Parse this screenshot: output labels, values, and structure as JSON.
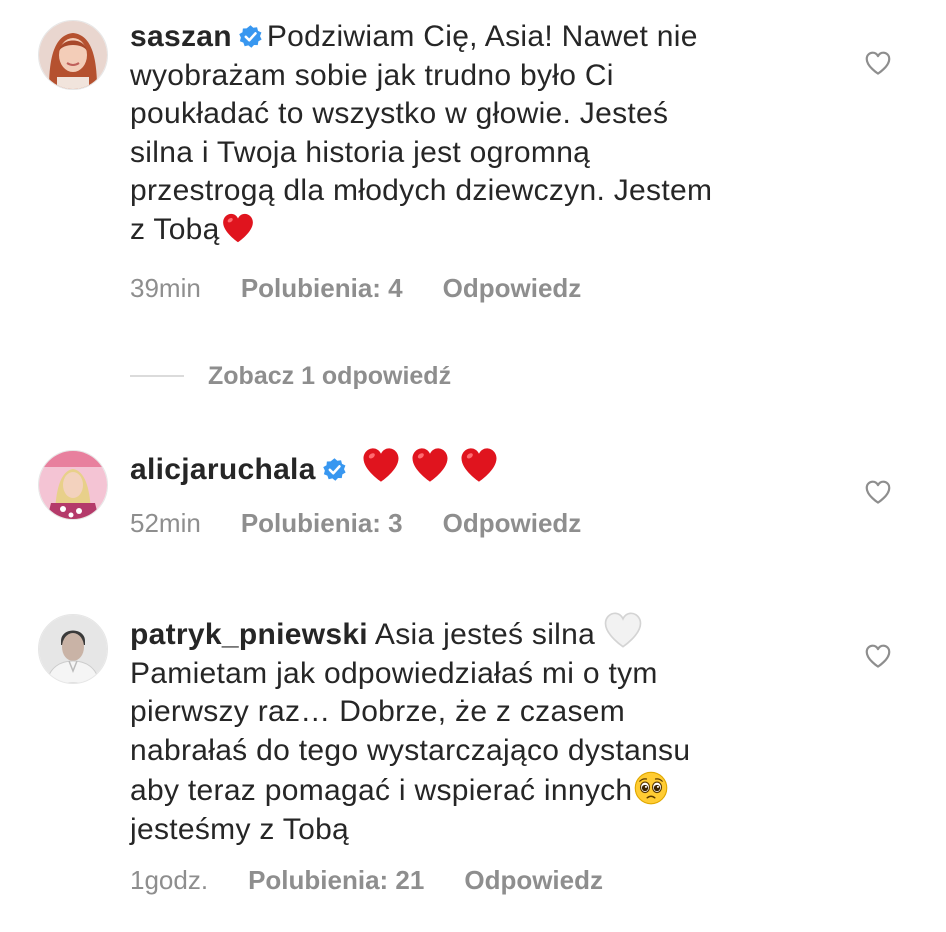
{
  "comments": [
    {
      "username": "saszan",
      "text_lines": [
        "Podziwiam Cię, Asia! Nawet nie",
        "wyobrażam sobie jak trudno było Ci",
        "poukładać to wszystko w głowie. Jesteś",
        "silna i Twoja historia jest ogromną",
        "przestrogą dla młodych dziewczyn. Jestem",
        "z Tobą"
      ],
      "time": "39min",
      "likes": "Polubienia: 4",
      "reply": "Odpowiedz"
    },
    {
      "username": "alicjaruchala",
      "time": "52min",
      "likes": "Polubienia: 3",
      "reply": "Odpowiedz"
    },
    {
      "username": "patryk_pniewski",
      "text_lines": [
        "Asia jesteś silna",
        "Pamietam jak odpowiedziałaś mi o tym",
        "pierwszy raz… Dobrze, że z czasem",
        "nabrałaś do tego wystarczająco dystansu",
        "aby teraz pomagać i wspierać innych",
        "jesteśmy z Tobą"
      ],
      "time": "1godz.",
      "likes": "Polubienia: 21",
      "reply": "Odpowiedz"
    }
  ],
  "view_replies": "Zobacz 1 odpowiedź",
  "icons": {
    "verified": "verified-badge-icon",
    "like": "heart-outline-icon",
    "red_heart": "red-heart-emoji",
    "white_heart": "white-heart-emoji",
    "pleading_face": "pleading-face-emoji"
  },
  "colors": {
    "text": "#262626",
    "meta": "#8e8e8e",
    "verified": "#3897f0",
    "heart": "#e0141e"
  }
}
